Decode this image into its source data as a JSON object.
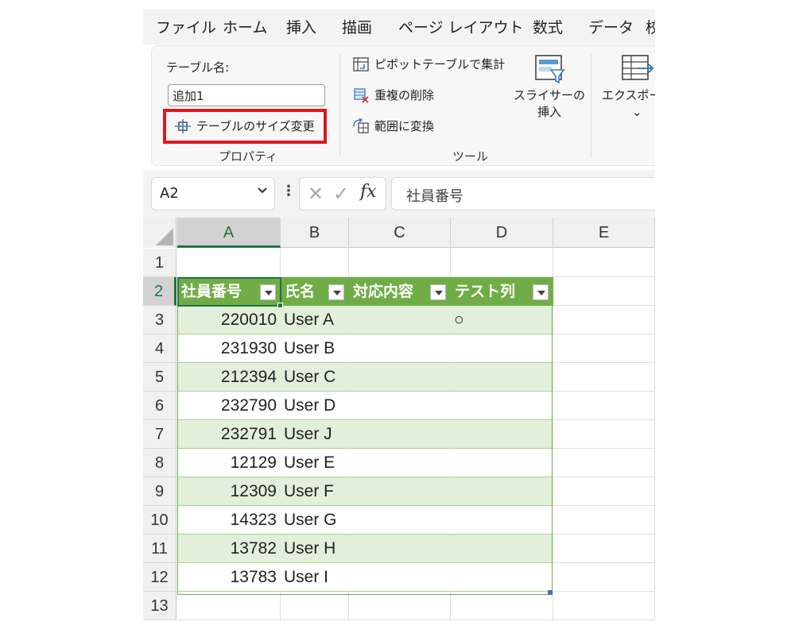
{
  "menu": {
    "tabs": [
      "ファイル",
      "ホーム",
      "挿入",
      "描画",
      "ページ レイアウト",
      "数式",
      "データ",
      "校"
    ]
  },
  "ribbon": {
    "properties": {
      "name_label": "テーブル名:",
      "name_value": "追加1",
      "resize_button": "テーブルのサイズ変更",
      "group_label": "プロパティ"
    },
    "tools": {
      "pivot_button": "ピボットテーブルで集計",
      "dedupe_button": "重複の削除",
      "convert_button": "範囲に変換",
      "slicer_button_line1": "スライサーの",
      "slicer_button_line2": "挿入",
      "group_label": "ツール"
    },
    "export": {
      "label": "エクスポー",
      "chevron": "⌄"
    },
    "colors": {
      "highlight": "#e0141d",
      "accent": "#217346"
    }
  },
  "formula_bar": {
    "name_box": "A2",
    "cancel": "✕",
    "enter": "✓",
    "fx": "fx",
    "formula": "社員番号"
  },
  "grid": {
    "columns": [
      "A",
      "B",
      "C",
      "D",
      "E"
    ],
    "selected_column": "A",
    "row_numbers": [
      "1",
      "2",
      "3",
      "4",
      "5",
      "6",
      "7",
      "8",
      "9",
      "10",
      "11",
      "12",
      "13"
    ],
    "selected_row": "2",
    "table": {
      "header_color": "#70ad47",
      "band_color": "#e2efda",
      "headers": [
        "社員番号",
        "氏名",
        "対応内容",
        "テスト列"
      ],
      "rows": [
        [
          "220010",
          "User A",
          "",
          "○"
        ],
        [
          "231930",
          "User B",
          "",
          ""
        ],
        [
          "212394",
          "User C",
          "",
          ""
        ],
        [
          "232790",
          "User D",
          "",
          ""
        ],
        [
          "232791",
          "User J",
          "",
          ""
        ],
        [
          "12129",
          "User E",
          "",
          ""
        ],
        [
          "12309",
          "User F",
          "",
          ""
        ],
        [
          "14323",
          "User G",
          "",
          ""
        ],
        [
          "13782",
          "User H",
          "",
          ""
        ],
        [
          "13783",
          "User I",
          "",
          ""
        ]
      ]
    }
  }
}
